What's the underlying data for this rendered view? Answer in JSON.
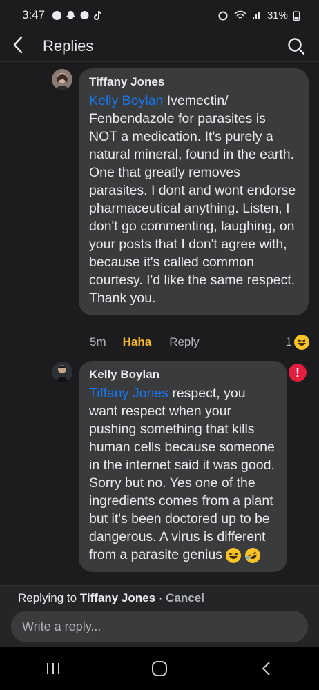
{
  "status_bar": {
    "time": "3:47",
    "battery": "31%"
  },
  "header": {
    "title": "Replies"
  },
  "comments": [
    {
      "author": "Tiffany Jones",
      "mention": "Kelly Boylan",
      "text": " Ivemectin/ Fenbendazole for parasites is NOT a medication. It's purely a natural mineral, found in the earth.  One that greatly removes parasites. I dont and wont endorse pharmaceutical anything. Listen, I don't go commenting, laughing, on your posts that I don't agree with, because it's called common courtesy. I'd like the same respect. Thank you.",
      "time": "5m",
      "reaction_label": "Haha",
      "reply_label": "Reply",
      "reaction_count": "1"
    },
    {
      "author": "Kelly Boylan",
      "mention": "Tiffany Jones",
      "text": " respect, you want respect when your pushing something that kills human cells because someone in the internet said it was good. Sorry but no. Yes one of the ingredients comes from a plant but it's been doctored up to be dangerous. A virus is different from a parasite genius ",
      "error_badge": "!"
    }
  ],
  "reply_bar": {
    "prefix": "Replying to ",
    "name": "Tiffany Jones",
    "separator": " · ",
    "cancel": "Cancel",
    "placeholder": "Write a reply..."
  },
  "colors": {
    "background": "#1c1c1e",
    "bubble": "#3a3b3c",
    "mention": "#1877f2",
    "haha": "#f7b928",
    "error": "#e41e3f"
  },
  "icons": [
    "back-arrow-icon",
    "search-icon",
    "haha-emoji-icon",
    "laughing-emoji-icon",
    "rofl-emoji-icon",
    "recents-icon",
    "home-icon",
    "nav-back-icon"
  ]
}
